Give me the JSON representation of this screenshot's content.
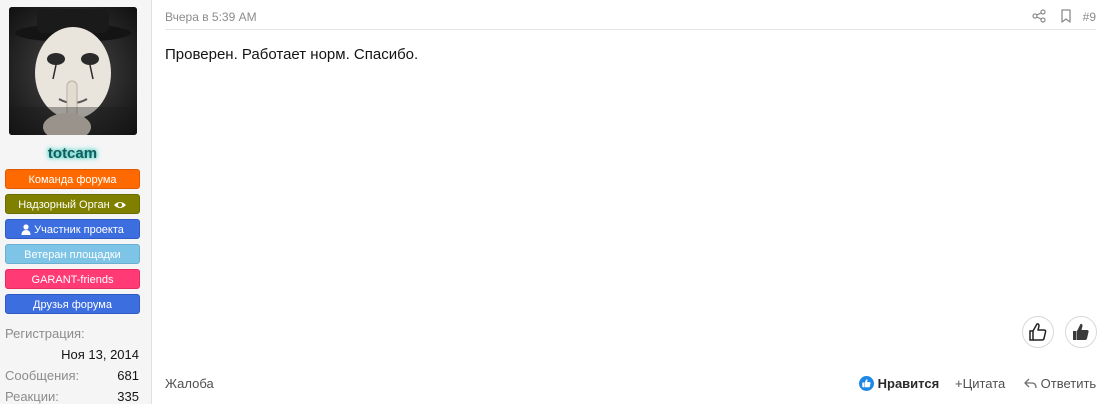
{
  "user": {
    "name": "totcam",
    "avatar_alt": "avatar",
    "badges": [
      {
        "label": "Команда форума",
        "color": "#ff6a00",
        "border": "#e05800",
        "icon": ""
      },
      {
        "label": "Надзорный Орган",
        "color": "#808000",
        "border": "#6b6b00",
        "icon": "eye-icon"
      },
      {
        "label": "Участник проекта",
        "color": "#3d6ee0",
        "border": "#2f5bc4",
        "icon": "user-icon"
      },
      {
        "label": "Ветеран площадки",
        "color": "#7ec4e6",
        "border": "#6ab0d2",
        "icon": ""
      },
      {
        "label": "GARANT-friends",
        "color": "#ff3a75",
        "border": "#e62a62",
        "icon": ""
      },
      {
        "label": "Друзья форума",
        "color": "#3d6ee0",
        "border": "#2f5bc4",
        "icon": ""
      }
    ],
    "stats": {
      "registration_label": "Регистрация:",
      "registration_value": "Ноя 13, 2014",
      "messages_label": "Сообщения:",
      "messages_value": "681",
      "reactions_label": "Реакции:",
      "reactions_value": "335"
    }
  },
  "post": {
    "time": "Вчера в 5:39 AM",
    "number": "#9",
    "content": "Проверен. Работает норм. Спасибо.",
    "report": "Жалоба",
    "like": "Нравится",
    "quote": "Цитата",
    "reply": "Ответить"
  },
  "icons": {
    "share": "share-icon",
    "bookmark": "bookmark-icon",
    "thumbs_up": "thumbs-up-icon",
    "thumbs_up_filled": "thumbs-up-filled-icon",
    "like_badge": "like-badge-icon",
    "plus": "plus-icon",
    "reply": "reply-icon"
  },
  "colors": {
    "accent": "#1e88e5",
    "username_glow": "#3fd4c8"
  }
}
